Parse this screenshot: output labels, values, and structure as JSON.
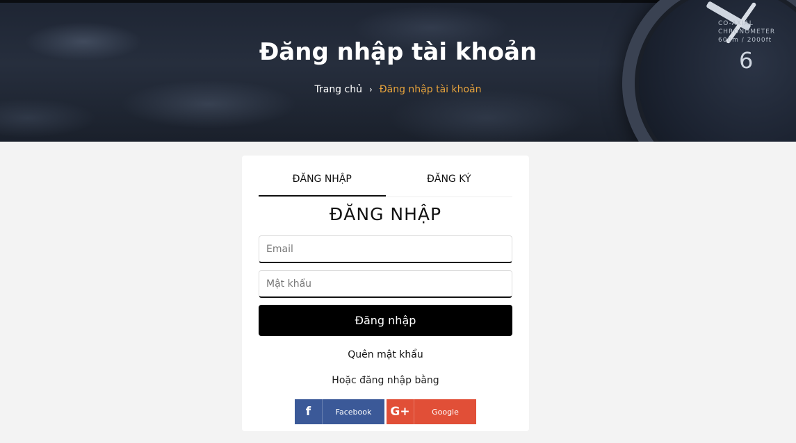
{
  "hero": {
    "title": "Đăng nhập tài khoản",
    "breadcrumb": {
      "home": "Trang chủ",
      "separator": "›",
      "current": "Đăng nhập tài khoản"
    },
    "watch_text": "CO-AXIAL\nCHRONOMETER\n600m / 2000ft",
    "watch_numeral": "6"
  },
  "tabs": [
    {
      "label": "ĐĂNG NHẬP",
      "active": true
    },
    {
      "label": "ĐĂNG KÝ",
      "active": false
    }
  ],
  "form": {
    "title": "ĐĂNG NHẬP",
    "email_placeholder": "Email",
    "email_value": "",
    "password_placeholder": "Mật khẩu",
    "password_value": "",
    "submit_label": "Đăng nhập",
    "forgot_label": "Quên mật khẩu",
    "or_label": "Hoặc đăng nhập bằng"
  },
  "social": {
    "facebook": {
      "label": "Facebook",
      "icon": "facebook-icon",
      "color": "#3b5998"
    },
    "google": {
      "label": "Google",
      "icon": "google-plus-icon",
      "color": "#e14f37"
    }
  },
  "colors": {
    "accent": "#e7a33c",
    "button": "#000000",
    "background": "#f3f3f3"
  }
}
